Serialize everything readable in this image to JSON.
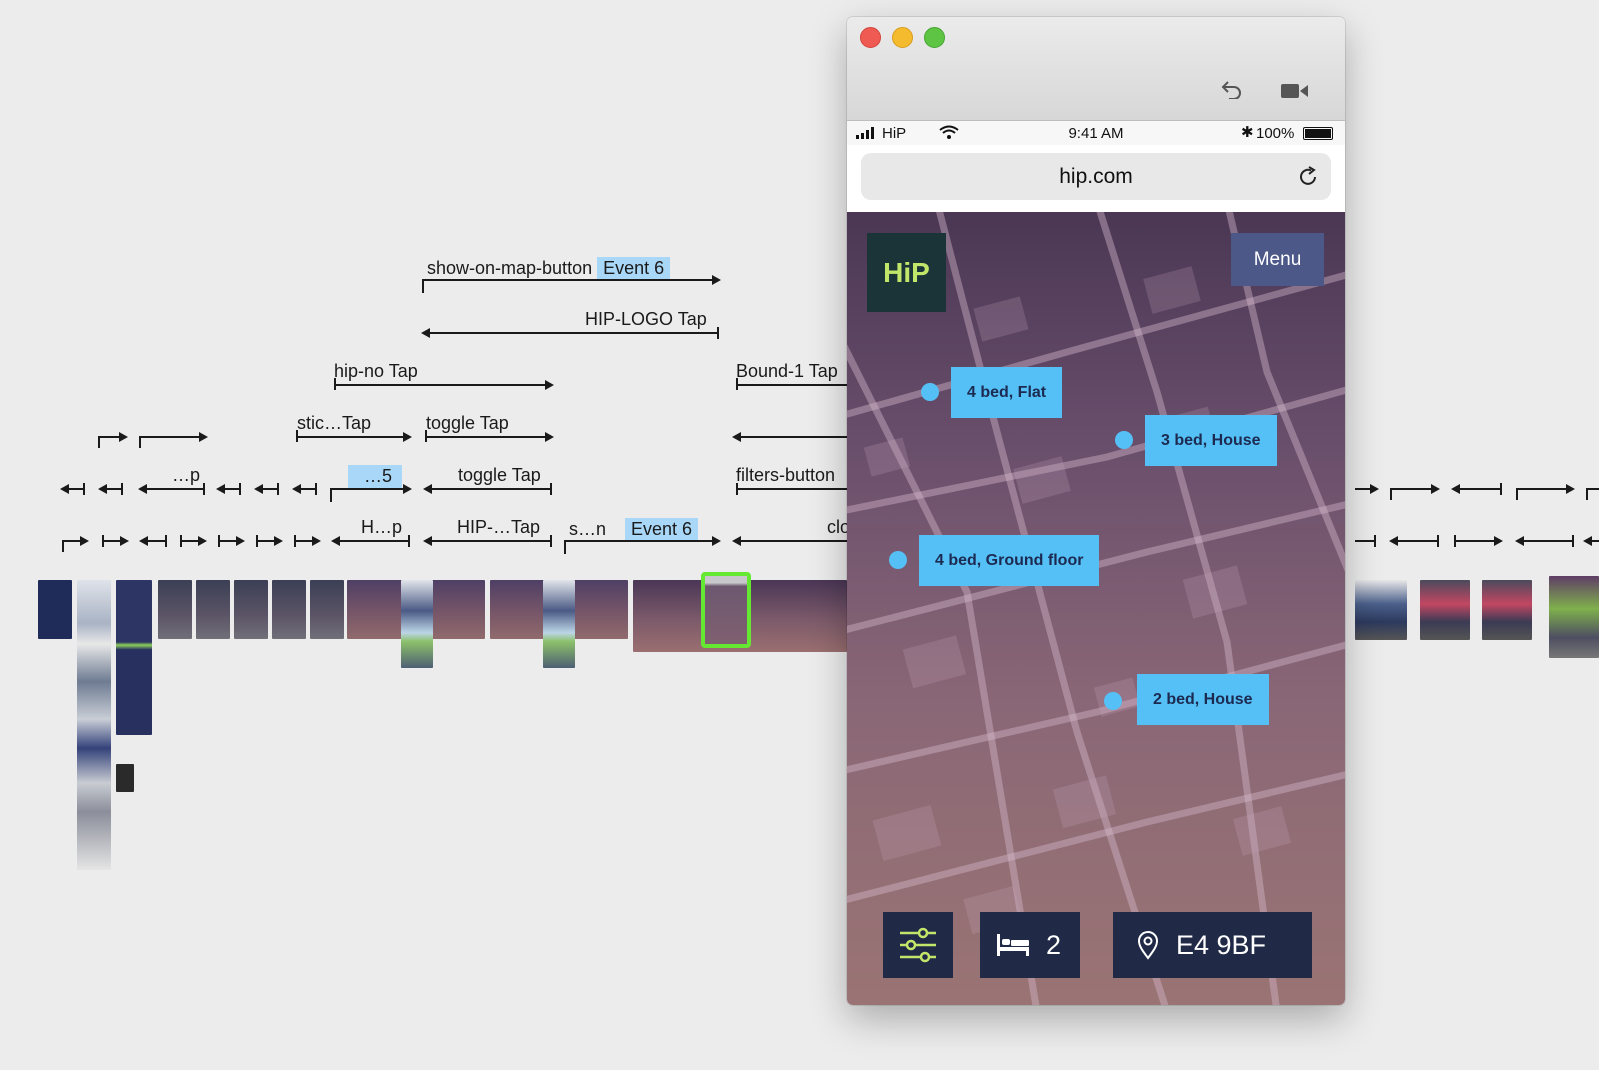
{
  "flow": {
    "labels": {
      "show_on_map": "show-on-map-button",
      "event_a": "Event 6",
      "hip_logo_tap": "HIP-LOGO Tap",
      "hip_no_tap": "hip-no Tap",
      "bound_tap": "Bound-1 Tap",
      "stic_tap": "stic…Tap",
      "toggle_tap_1": "toggle Tap",
      "toggle_tap_2": "toggle Tap",
      "dots_p": "…p",
      "dots_5": "…5",
      "filters_button": "filters-button",
      "h_p": "H…p",
      "hip_tap": "HIP-…Tap",
      "s_n": "s…n",
      "event_b": "Event 6",
      "clo": "clo"
    }
  },
  "window": {
    "status": {
      "carrier": "HiP",
      "time": "9:41 AM",
      "battery": "100%"
    },
    "url": "hip.com",
    "app": {
      "logo": "HiP",
      "menu_label": "Menu",
      "pins": [
        "4 bed, Flat",
        "3 bed, House",
        "4 bed, Ground floor",
        "2 bed, House"
      ],
      "bedrooms": "2",
      "postcode": "E4 9BF"
    }
  },
  "colors": {
    "pin": "#55c0f5",
    "button": "#202a47",
    "logo_bg": "#1b3437",
    "logo_fg": "#c2e66a",
    "menu_bg": "#4b5888",
    "highlight": "#64e832"
  }
}
